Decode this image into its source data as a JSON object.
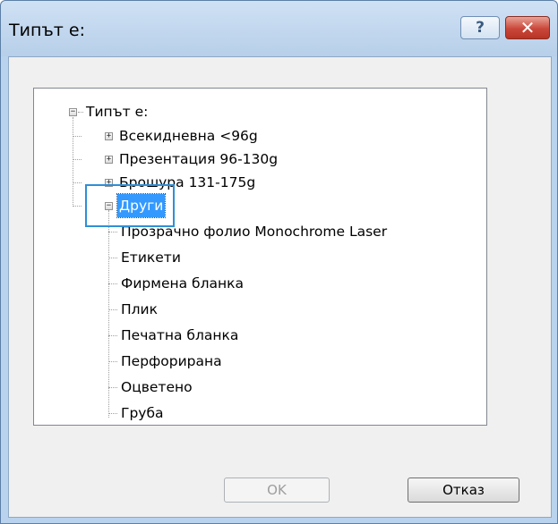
{
  "window": {
    "title": "Типът е:"
  },
  "titlebar_buttons": {
    "help": "?",
    "close": "✕"
  },
  "tree": {
    "root": "Типът е:",
    "root_expander": "−",
    "items": [
      {
        "label": "Всекидневна <96g",
        "expander": "+"
      },
      {
        "label": "Презентация 96-130g",
        "expander": "+"
      },
      {
        "label": "Брошура 131-175g",
        "expander": "+"
      },
      {
        "label": "Други",
        "expander": "−",
        "selected": true,
        "children": [
          "Прозрачно фолио Monochrome Laser",
          "Етикети",
          "Фирмена бланка",
          "Плик",
          "Печатна бланка",
          "Перфорирана",
          "Оцветено",
          "Груба"
        ]
      }
    ]
  },
  "buttons": {
    "ok": "OK",
    "cancel": "Отказ"
  }
}
